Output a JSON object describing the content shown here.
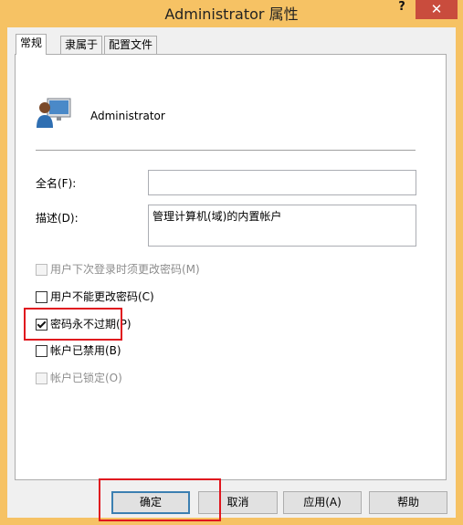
{
  "window": {
    "title": "Administrator 属性",
    "help_label": "?",
    "close_label": "✕"
  },
  "tabs": [
    {
      "label": "常规",
      "active": true
    },
    {
      "label": "隶属于",
      "active": false
    },
    {
      "label": "配置文件",
      "active": false
    }
  ],
  "general": {
    "username": "Administrator",
    "avatar_icon": "user-avatar-icon",
    "fullname_label": "全名(F):",
    "fullname_value": "",
    "description_label": "描述(D):",
    "description_value": "管理计算机(域)的内置帐户"
  },
  "checkboxes": [
    {
      "label": "用户下次登录时须更改密码(M)",
      "checked": false,
      "disabled": true
    },
    {
      "label": "用户不能更改密码(C)",
      "checked": false,
      "disabled": false
    },
    {
      "label": "密码永不过期(P)",
      "checked": true,
      "disabled": false
    },
    {
      "label": "帐户已禁用(B)",
      "checked": false,
      "disabled": false
    },
    {
      "label": "帐户已锁定(O)",
      "checked": false,
      "disabled": true
    }
  ],
  "buttons": {
    "ok": "确定",
    "cancel": "取消",
    "apply": "应用(A)",
    "help": "帮助"
  },
  "colors": {
    "titlebar": "#f6c264",
    "close_button": "#c94c3d",
    "highlight": "#e0161e"
  }
}
